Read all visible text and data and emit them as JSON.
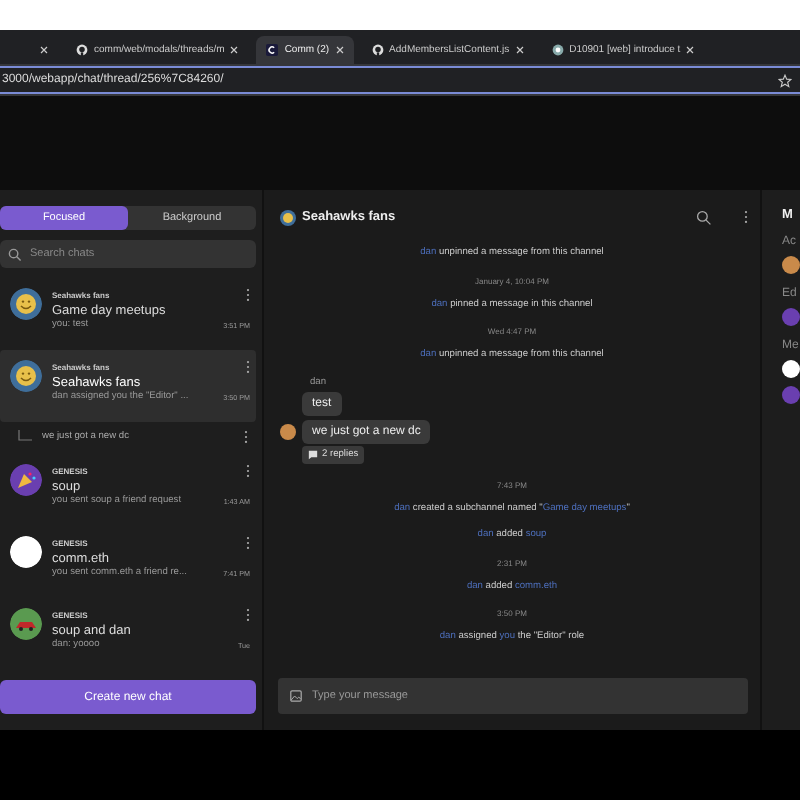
{
  "browser": {
    "tabs": [
      {
        "selected": false
      },
      {
        "title": "comm/web/modals/threads/m",
        "selected": false
      },
      {
        "title": "Comm (2)",
        "selected": true
      },
      {
        "title": "AddMembersListContent.js",
        "selected": false
      },
      {
        "title": "D10901 [web] introduce t",
        "selected": false
      }
    ],
    "url": "3000/webapp/chat/thread/256%7C84260/"
  },
  "sidebar": {
    "tabs": [
      {
        "label": "Focused",
        "selected": true
      },
      {
        "label": "Background",
        "selected": false
      }
    ],
    "search": {
      "placeholder": "Search chats"
    },
    "chats": [
      {
        "community": "Seahawks fans",
        "name": "Game day meetups",
        "preview": "you: test",
        "time": "3:51 PM",
        "color": "#3f6e9a",
        "selected": false
      },
      {
        "community": "Seahawks fans",
        "name": "Seahawks fans",
        "preview": "dan assigned you the \"Editor\" ...",
        "time": "3:50 PM",
        "color": "#3f6e9a",
        "selected": true,
        "threads": [
          {
            "name": "we just got a new dc"
          }
        ]
      },
      {
        "community": "GENESIS",
        "name": "soup",
        "preview": "you sent soup a friend request",
        "time": "1:43 AM",
        "color": "#6a3fb0",
        "selected": false
      },
      {
        "community": "GENESIS",
        "name": "comm.eth",
        "preview": "you sent comm.eth a friend re...",
        "time": "7:41 PM",
        "color": "#ffffff",
        "selected": false
      },
      {
        "community": "GENESIS",
        "name": "soup and dan",
        "preview": "dan: yoooo",
        "time": "Tue",
        "color": "#5a9a50",
        "selected": false
      }
    ],
    "button": "Create new chat"
  },
  "thread": {
    "title": "Seahawks fans",
    "messages": [
      {
        "kind": "notice",
        "parts": [
          {
            "text": "dan",
            "link": true
          },
          {
            "text": " unpinned a message from this channel",
            "link": false
          }
        ]
      },
      {
        "kind": "time",
        "text": "January 4, 10:04 PM"
      },
      {
        "kind": "notice",
        "parts": [
          {
            "text": "dan",
            "link": true
          },
          {
            "text": " pinned a message in this channel",
            "link": false
          }
        ]
      },
      {
        "kind": "time",
        "text": "Wed 4:47 PM"
      },
      {
        "kind": "notice",
        "parts": [
          {
            "text": "dan",
            "link": true
          },
          {
            "text": " unpinned a message from this channel",
            "link": false
          }
        ]
      },
      {
        "kind": "author",
        "text": "dan"
      },
      {
        "kind": "bubble",
        "text": "test",
        "avatar": false
      },
      {
        "kind": "bubble",
        "text": "we just got a new dc",
        "avatar": true
      },
      {
        "kind": "replies",
        "text": "2 replies"
      },
      {
        "kind": "time",
        "text": "7:43 PM"
      },
      {
        "kind": "notice",
        "parts": [
          {
            "text": "dan",
            "link": true
          },
          {
            "text": " created a subchannel named \"",
            "link": false
          },
          {
            "text": "Game day meetups",
            "link": true
          },
          {
            "text": "\"",
            "link": false
          }
        ]
      },
      {
        "kind": "notice",
        "parts": [
          {
            "text": "dan",
            "link": true
          },
          {
            "text": " added ",
            "link": false
          },
          {
            "text": "soup",
            "link": true
          }
        ]
      },
      {
        "kind": "time",
        "text": "2:31 PM"
      },
      {
        "kind": "notice",
        "parts": [
          {
            "text": "dan",
            "link": true
          },
          {
            "text": " added ",
            "link": false
          },
          {
            "text": "comm.eth",
            "link": true
          }
        ]
      },
      {
        "kind": "time",
        "text": "3:50 PM"
      },
      {
        "kind": "notice",
        "parts": [
          {
            "text": "dan",
            "link": true
          },
          {
            "text": " assigned ",
            "link": false
          },
          {
            "text": "you",
            "link": true
          },
          {
            "text": " the \"Editor\" role",
            "link": false
          }
        ]
      }
    ],
    "composer": {
      "placeholder": "Type your message"
    }
  },
  "right_panel": {
    "title": "M",
    "sections": [
      {
        "label": "Ac",
        "members": [
          {
            "color": "#c98a4a"
          }
        ]
      },
      {
        "label": "Ed",
        "members": [
          {
            "color": "#6a3fb0"
          }
        ]
      },
      {
        "label": "Me",
        "members": [
          {
            "color": "#ffffff"
          },
          {
            "color": "#6a3fb0"
          }
        ]
      }
    ]
  }
}
